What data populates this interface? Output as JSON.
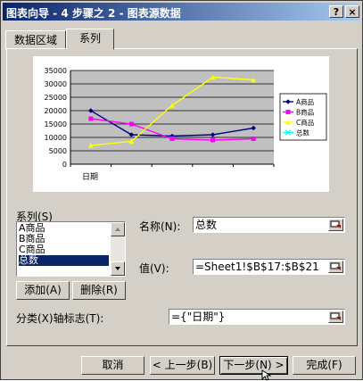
{
  "window": {
    "title": "图表向导 - 4 步骤之 2 - 图表源数据",
    "help_button": "?",
    "close_button": "×"
  },
  "tabs": [
    {
      "label": "数据区域",
      "selected": false
    },
    {
      "label": "系列",
      "selected": true
    }
  ],
  "series_group": {
    "label": "系列(S)",
    "items": [
      "A商品",
      "B商品",
      "C商品",
      "总数"
    ],
    "selected_index": 3,
    "add_label": "添加(A)",
    "delete_label": "删除(R)"
  },
  "name_field": {
    "label": "名称(N):",
    "value": "总数"
  },
  "values_field": {
    "label": "值(V):",
    "value": "=Sheet1!$B$17:$B$21"
  },
  "category_field": {
    "label": "分类(X)轴标志(T):",
    "value": "={\"日期\"}"
  },
  "buttons": {
    "cancel": "取消",
    "back": "< 上一步(B)",
    "next": "下一步(N) >",
    "finish": "完成(F)"
  },
  "chart_data": {
    "type": "line",
    "categories": [
      "1",
      "2",
      "3",
      "4",
      "5"
    ],
    "xlabel": "日期",
    "ylim": [
      0,
      35000
    ],
    "yticks": [
      0,
      5000,
      10000,
      15000,
      20000,
      25000,
      30000,
      35000
    ],
    "legend_position": "right",
    "series": [
      {
        "name": "A商品",
        "color": "#000080",
        "marker": "diamond",
        "values": [
          20000,
          11000,
          10500,
          11000,
          13500
        ]
      },
      {
        "name": "B商品",
        "color": "#ff00ff",
        "marker": "square",
        "values": [
          17000,
          15000,
          9500,
          9000,
          9500
        ]
      },
      {
        "name": "C商品",
        "color": "#ffff00",
        "marker": "triangle",
        "values": [
          7000,
          8500,
          22000,
          32500,
          31500
        ]
      },
      {
        "name": "总数",
        "color": "#00ffff",
        "marker": "x",
        "values": []
      }
    ]
  }
}
